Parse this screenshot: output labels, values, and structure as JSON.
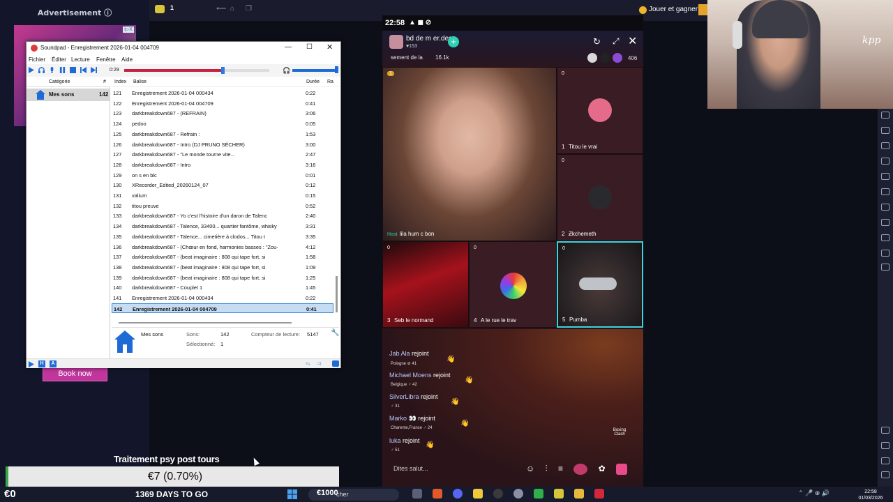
{
  "ad": {
    "title": "Advertisement ⓘ",
    "badge": "i▷X",
    "book_now": "Book now"
  },
  "top_bar": {
    "count": "1",
    "play_earn": "Jouer et gagner"
  },
  "webcam": {
    "logo": "kpp"
  },
  "phone": {
    "status_time": "22:58",
    "status_icons": "▲ ◼ ⊘",
    "room_name": "bd de m er.des",
    "room_followers": "♥153",
    "follow": "+",
    "share": "↻",
    "minimize": "⤢",
    "close": "✕",
    "subtitle": "sement de la",
    "coins": "16.1k",
    "viewers": "406",
    "host_tile": {
      "coin": "1",
      "host_badge": "Host",
      "name": "lila hum c bon"
    },
    "tiles": [
      {
        "coin": "0",
        "num": "1",
        "name": "Titou le vrai"
      },
      {
        "coin": "0",
        "num": "2",
        "name": "Ƶkchemeth"
      },
      {
        "coin": "0",
        "num": "3",
        "name": "Seb le normand"
      },
      {
        "coin": "0",
        "num": "4",
        "name": "A le rue le trav"
      },
      {
        "coin": "0",
        "num": "5",
        "name": "Pumba"
      }
    ],
    "chat": [
      {
        "name": "Jab Ala",
        "action": "rejoint",
        "meta": "Pologne  ⊘ 41"
      },
      {
        "name": "Michael Moens",
        "action": "rejoint",
        "meta": "Belgique  ♂ 42"
      },
      {
        "name": "SilverLibra",
        "action": "rejoint",
        "meta": "♂ 31"
      },
      {
        "name": "Marko 👀",
        "action": "rejoint",
        "meta": "Charente,France  ♂ 24"
      },
      {
        "name": "luka",
        "action": "rejoint",
        "meta": "♂ 51"
      }
    ],
    "boxing": "Boxing Clash",
    "input_placeholder": "Dites salut..."
  },
  "soundpad": {
    "title": "Soundpad - Enregistrement 2026-01-04 004709",
    "menu": [
      "Fichier",
      "Éditer",
      "Lecture",
      "Fenêtre",
      "Aide"
    ],
    "time": "0:29",
    "progress": 0.68,
    "volume": 0.95,
    "category_header": "Catégorie",
    "category_count_header": "#",
    "category": {
      "name": "Mes sons",
      "count": "142"
    },
    "columns": {
      "index": "Index",
      "tag": "Balise",
      "duration": "Durée",
      "rating": "Ra"
    },
    "rows": [
      {
        "index": "121",
        "tag": "Enregistrement 2026-01-04 000434",
        "duration": "0:22"
      },
      {
        "index": "122",
        "tag": "Enregistrement 2026-01-04 004709",
        "duration": "0:41"
      },
      {
        "index": "123",
        "tag": "darkbreakdown687 - (REFRAIN)",
        "duration": "3:06"
      },
      {
        "index": "124",
        "tag": "pedoo",
        "duration": "0:05"
      },
      {
        "index": "125",
        "tag": "darkbreakdown687 - Refrain :",
        "duration": "1:53"
      },
      {
        "index": "126",
        "tag": "darkbreakdown687 - Intro (DJ PRUNO SÉCHER)",
        "duration": "3:00"
      },
      {
        "index": "127",
        "tag": "darkbreakdown687 - \"Le monde tourne vite...",
        "duration": "2:47"
      },
      {
        "index": "128",
        "tag": "darkbreakdown687 - Intro",
        "duration": "3:16"
      },
      {
        "index": "129",
        "tag": "on s en blc",
        "duration": "0:01"
      },
      {
        "index": "130",
        "tag": "XRecorder_Edited_20260124_07",
        "duration": "0:12"
      },
      {
        "index": "131",
        "tag": "valium",
        "duration": "0:15"
      },
      {
        "index": "132",
        "tag": "titou preuve",
        "duration": "0:52"
      },
      {
        "index": "133",
        "tag": "darkbreakdown687 - Yo c'est l'histoire d'un daron de Talenc",
        "duration": "2:40"
      },
      {
        "index": "134",
        "tag": "darkbreakdown687 - Talence, 33400... quartier fantôme, whisky",
        "duration": "3:31"
      },
      {
        "index": "135",
        "tag": "darkbreakdown687 - Talence... cimetière à clodos... Titou t",
        "duration": "3:35"
      },
      {
        "index": "136",
        "tag": "darkbreakdown687 - (Chœur en fond, harmonies basses : \"Zou-",
        "duration": "4:12"
      },
      {
        "index": "137",
        "tag": "darkbreakdown687 - (beat imaginaire : 808 qui tape fort, si",
        "duration": "1:58"
      },
      {
        "index": "138",
        "tag": "darkbreakdown687 - (beat imaginaire : 808 qui tape fort, si",
        "duration": "1:09"
      },
      {
        "index": "139",
        "tag": "darkbreakdown687 - (beat imaginaire : 808 qui tape fort, si",
        "duration": "1:25"
      },
      {
        "index": "140",
        "tag": "darkbreakdown687 - Couplet 1",
        "duration": "1:45"
      },
      {
        "index": "141",
        "tag": "Enregistrement 2026-01-04 000434",
        "duration": "0:22"
      },
      {
        "index": "142",
        "tag": "Enregistrement 2026-01-04 004709",
        "duration": "0:41"
      }
    ],
    "selected_index": 21,
    "info": {
      "category": "Mes sons",
      "sounds_label": "Sons:",
      "sounds_value": "142",
      "selected_label": "Sélectionné:",
      "selected_value": "1",
      "play_counter_label": "Compteur de lecture:",
      "play_counter_value": "5147"
    }
  },
  "overlay": {
    "traitement": "Traitement psy post tours",
    "donation": "€7 (0.70%)"
  },
  "taskbar": {
    "left_amount": "€0",
    "days": "1369 DAYS TO GO",
    "search_amount": "€1000",
    "search_text": "cher",
    "clock_time": "22:58",
    "clock_date": "01/03/2026",
    "tray": "⌃  🎤  ⊕  🔊"
  }
}
